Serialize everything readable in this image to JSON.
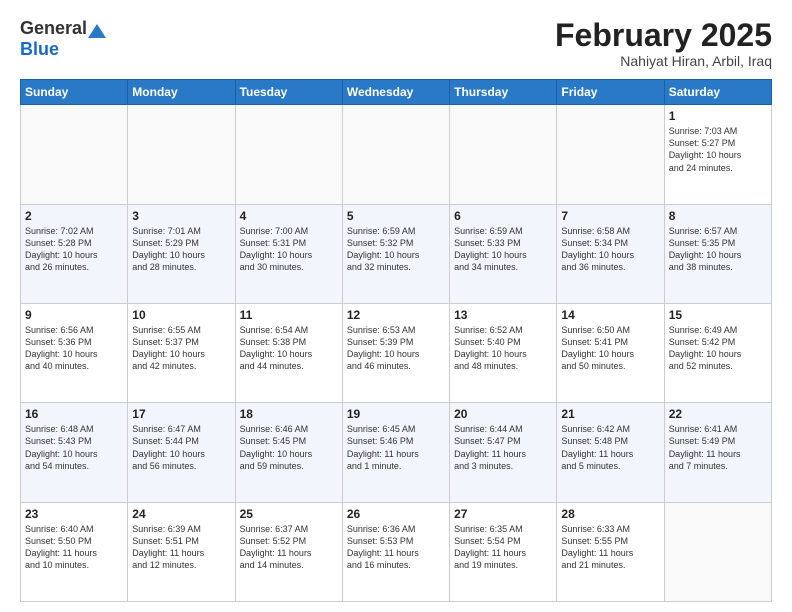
{
  "header": {
    "logo_general": "General",
    "logo_blue": "Blue",
    "month_title": "February 2025",
    "location": "Nahiyat Hiran, Arbil, Iraq"
  },
  "days_of_week": [
    "Sunday",
    "Monday",
    "Tuesday",
    "Wednesday",
    "Thursday",
    "Friday",
    "Saturday"
  ],
  "weeks": [
    [
      {
        "day": "",
        "info": ""
      },
      {
        "day": "",
        "info": ""
      },
      {
        "day": "",
        "info": ""
      },
      {
        "day": "",
        "info": ""
      },
      {
        "day": "",
        "info": ""
      },
      {
        "day": "",
        "info": ""
      },
      {
        "day": "1",
        "info": "Sunrise: 7:03 AM\nSunset: 5:27 PM\nDaylight: 10 hours\nand 24 minutes."
      }
    ],
    [
      {
        "day": "2",
        "info": "Sunrise: 7:02 AM\nSunset: 5:28 PM\nDaylight: 10 hours\nand 26 minutes."
      },
      {
        "day": "3",
        "info": "Sunrise: 7:01 AM\nSunset: 5:29 PM\nDaylight: 10 hours\nand 28 minutes."
      },
      {
        "day": "4",
        "info": "Sunrise: 7:00 AM\nSunset: 5:31 PM\nDaylight: 10 hours\nand 30 minutes."
      },
      {
        "day": "5",
        "info": "Sunrise: 6:59 AM\nSunset: 5:32 PM\nDaylight: 10 hours\nand 32 minutes."
      },
      {
        "day": "6",
        "info": "Sunrise: 6:59 AM\nSunset: 5:33 PM\nDaylight: 10 hours\nand 34 minutes."
      },
      {
        "day": "7",
        "info": "Sunrise: 6:58 AM\nSunset: 5:34 PM\nDaylight: 10 hours\nand 36 minutes."
      },
      {
        "day": "8",
        "info": "Sunrise: 6:57 AM\nSunset: 5:35 PM\nDaylight: 10 hours\nand 38 minutes."
      }
    ],
    [
      {
        "day": "9",
        "info": "Sunrise: 6:56 AM\nSunset: 5:36 PM\nDaylight: 10 hours\nand 40 minutes."
      },
      {
        "day": "10",
        "info": "Sunrise: 6:55 AM\nSunset: 5:37 PM\nDaylight: 10 hours\nand 42 minutes."
      },
      {
        "day": "11",
        "info": "Sunrise: 6:54 AM\nSunset: 5:38 PM\nDaylight: 10 hours\nand 44 minutes."
      },
      {
        "day": "12",
        "info": "Sunrise: 6:53 AM\nSunset: 5:39 PM\nDaylight: 10 hours\nand 46 minutes."
      },
      {
        "day": "13",
        "info": "Sunrise: 6:52 AM\nSunset: 5:40 PM\nDaylight: 10 hours\nand 48 minutes."
      },
      {
        "day": "14",
        "info": "Sunrise: 6:50 AM\nSunset: 5:41 PM\nDaylight: 10 hours\nand 50 minutes."
      },
      {
        "day": "15",
        "info": "Sunrise: 6:49 AM\nSunset: 5:42 PM\nDaylight: 10 hours\nand 52 minutes."
      }
    ],
    [
      {
        "day": "16",
        "info": "Sunrise: 6:48 AM\nSunset: 5:43 PM\nDaylight: 10 hours\nand 54 minutes."
      },
      {
        "day": "17",
        "info": "Sunrise: 6:47 AM\nSunset: 5:44 PM\nDaylight: 10 hours\nand 56 minutes."
      },
      {
        "day": "18",
        "info": "Sunrise: 6:46 AM\nSunset: 5:45 PM\nDaylight: 10 hours\nand 59 minutes."
      },
      {
        "day": "19",
        "info": "Sunrise: 6:45 AM\nSunset: 5:46 PM\nDaylight: 11 hours\nand 1 minute."
      },
      {
        "day": "20",
        "info": "Sunrise: 6:44 AM\nSunset: 5:47 PM\nDaylight: 11 hours\nand 3 minutes."
      },
      {
        "day": "21",
        "info": "Sunrise: 6:42 AM\nSunset: 5:48 PM\nDaylight: 11 hours\nand 5 minutes."
      },
      {
        "day": "22",
        "info": "Sunrise: 6:41 AM\nSunset: 5:49 PM\nDaylight: 11 hours\nand 7 minutes."
      }
    ],
    [
      {
        "day": "23",
        "info": "Sunrise: 6:40 AM\nSunset: 5:50 PM\nDaylight: 11 hours\nand 10 minutes."
      },
      {
        "day": "24",
        "info": "Sunrise: 6:39 AM\nSunset: 5:51 PM\nDaylight: 11 hours\nand 12 minutes."
      },
      {
        "day": "25",
        "info": "Sunrise: 6:37 AM\nSunset: 5:52 PM\nDaylight: 11 hours\nand 14 minutes."
      },
      {
        "day": "26",
        "info": "Sunrise: 6:36 AM\nSunset: 5:53 PM\nDaylight: 11 hours\nand 16 minutes."
      },
      {
        "day": "27",
        "info": "Sunrise: 6:35 AM\nSunset: 5:54 PM\nDaylight: 11 hours\nand 19 minutes."
      },
      {
        "day": "28",
        "info": "Sunrise: 6:33 AM\nSunset: 5:55 PM\nDaylight: 11 hours\nand 21 minutes."
      },
      {
        "day": "",
        "info": ""
      }
    ]
  ]
}
